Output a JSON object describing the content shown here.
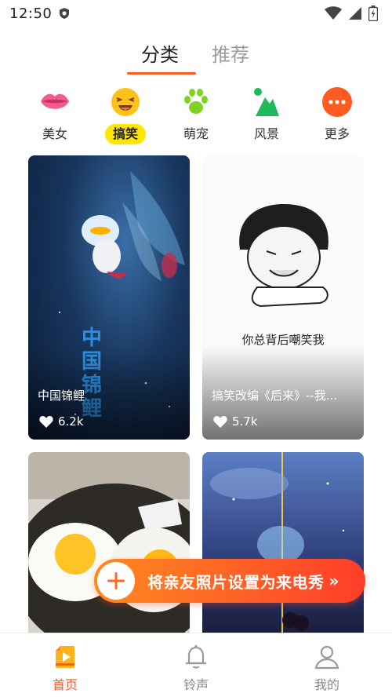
{
  "status_bar": {
    "time": "12:50",
    "icons": [
      "shield-icon",
      "wifi-icon",
      "signal-icon",
      "battery-icon"
    ]
  },
  "top_tabs": [
    {
      "label": "分类",
      "active": true
    },
    {
      "label": "推荐",
      "active": false
    }
  ],
  "categories": [
    {
      "label": "美女",
      "icon": "lips-icon",
      "active": false
    },
    {
      "label": "搞笑",
      "icon": "laughing-face-icon",
      "active": true
    },
    {
      "label": "萌宠",
      "icon": "paw-icon",
      "active": false
    },
    {
      "label": "风景",
      "icon": "mountain-icon",
      "active": false
    },
    {
      "label": "更多",
      "icon": "more-icon",
      "active": false
    }
  ],
  "feed": [
    {
      "title": "中国锦鲤",
      "likes": "6.2k",
      "caption": "中国锦鲤"
    },
    {
      "title": "搞笑改编《后来》--我...",
      "likes": "5.7k",
      "caption": "你总背后嘲笑我"
    },
    {
      "title": "",
      "likes": ""
    },
    {
      "title": "",
      "likes": ""
    }
  ],
  "promo": {
    "label": "将亲友照片设置为来电秀",
    "arrow": "»"
  },
  "bottom_nav": [
    {
      "label": "首页",
      "icon": "home-play-icon",
      "active": true
    },
    {
      "label": "铃声",
      "icon": "bell-icon",
      "active": false
    },
    {
      "label": "我的",
      "icon": "profile-icon",
      "active": false
    }
  ],
  "colors": {
    "accent": "#ff5a1f",
    "active_badge": "#ffe600",
    "promo_start": "#ff8a1f",
    "promo_end": "#ff3d2a"
  }
}
